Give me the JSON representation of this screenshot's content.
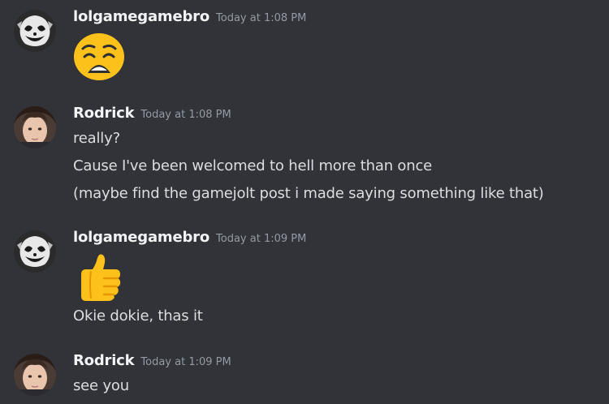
{
  "messages": [
    {
      "username": "lolgamegamebro",
      "timestamp": "Today at 1:08 PM",
      "emoji": "weary-face-emoji",
      "lines": []
    },
    {
      "username": "Rodrick",
      "timestamp": "Today at 1:08 PM",
      "lines": [
        "really?",
        "Cause I've been welcomed to hell more than once",
        "(maybe find the gamejolt post i made saying something like that)"
      ]
    },
    {
      "username": "lolgamegamebro",
      "timestamp": "Today at 1:09 PM",
      "emoji": "thumbs-up-emoji",
      "lines": [
        "Okie dokie, thas it"
      ]
    },
    {
      "username": "Rodrick",
      "timestamp": "Today at 1:09 PM",
      "lines": [
        "see you"
      ]
    }
  ],
  "colors": {
    "background": "#313338",
    "username": "#f2f3f5",
    "timestamp": "#949ba4",
    "message_text": "#dbdee1",
    "emoji_yellow": "#fcc21b"
  }
}
